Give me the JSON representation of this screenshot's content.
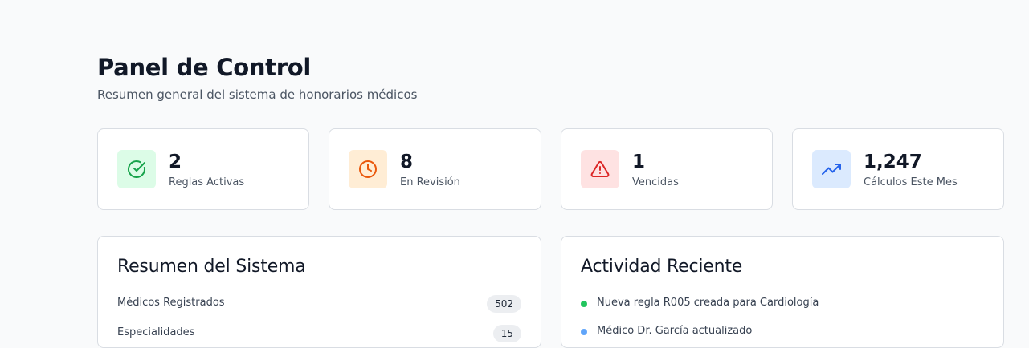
{
  "header": {
    "title": "Panel de Control",
    "subtitle": "Resumen general del sistema de honorarios médicos"
  },
  "stats": [
    {
      "value": "2",
      "label": "Reglas Activas",
      "icon": "check-circle-icon",
      "color": "#16a34a",
      "bg": "#dcfce7"
    },
    {
      "value": "8",
      "label": "En Revisión",
      "icon": "clock-icon",
      "color": "#ea580c",
      "bg": "#ffedd5"
    },
    {
      "value": "1",
      "label": "Vencidas",
      "icon": "alert-triangle-icon",
      "color": "#dc2626",
      "bg": "#fee2e2"
    },
    {
      "value": "1,247",
      "label": "Cálculos Este Mes",
      "icon": "trending-up-icon",
      "color": "#2563eb",
      "bg": "#dbeafe"
    }
  ],
  "summary": {
    "title": "Resumen del Sistema",
    "rows": [
      {
        "label": "Médicos Registrados",
        "value": "502"
      },
      {
        "label": "Especialidades",
        "value": "15"
      }
    ]
  },
  "activity": {
    "title": "Actividad Reciente",
    "items": [
      {
        "text": "Nueva regla R005 creada para Cardiología",
        "color": "#22c55e"
      },
      {
        "text": "Médico Dr. García actualizado",
        "color": "#3b82f6"
      }
    ]
  }
}
